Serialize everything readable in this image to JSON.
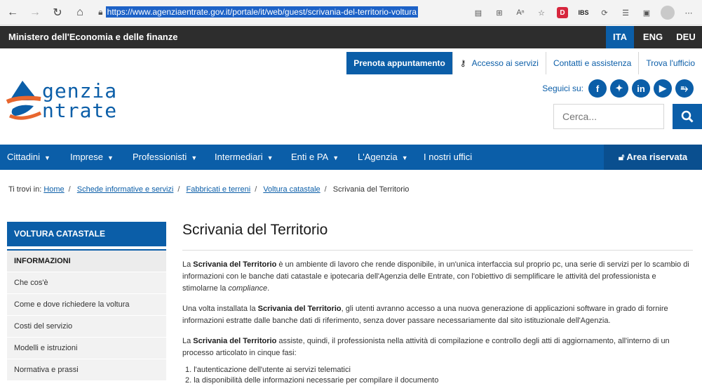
{
  "browser": {
    "url": "https://www.agenziaentrate.gov.it/portale/it/web/guest/scrivania-del-territorio-voltura",
    "icons": [
      "back-icon",
      "forward-icon",
      "refresh-icon",
      "home-icon",
      "lock-icon"
    ],
    "tool_ibs": "IBS",
    "tool_d": "D"
  },
  "ministry": {
    "title": "Ministero dell'Economia e delle finanze",
    "langs": [
      "ITA",
      "ENG",
      "DEU"
    ]
  },
  "header": {
    "links": {
      "prenota": "Prenota appuntamento",
      "accesso": "Accesso ai servizi",
      "contatti": "Contatti e assistenza",
      "trova": "Trova l'ufficio"
    },
    "logo_line1": "genzia",
    "logo_line2": "ntrate",
    "social_label": "Seguici su:",
    "social": [
      "f",
      "t",
      "in",
      "▶",
      "rss"
    ],
    "search_placeholder": "Cerca..."
  },
  "nav": {
    "items": [
      "Cittadini",
      "Imprese",
      "Professionisti",
      "Intermediari",
      "Enti e PA",
      "L'Agenzia",
      "I nostri uffici"
    ],
    "area_riservata": "Area riservata"
  },
  "breadcrumb": {
    "prefix": "Ti trovi in:",
    "links": [
      "Home",
      "Schede informative e servizi",
      "Fabbricati e terreni",
      "Voltura catastale"
    ],
    "current": "Scrivania del Territorio"
  },
  "sidebar": {
    "title": "VOLTURA CATASTALE",
    "items": [
      "INFORMAZIONI",
      "Che cos'è",
      "Come e dove richiedere la voltura",
      "Costi del servizio",
      "Modelli e istruzioni",
      "Normativa e prassi"
    ]
  },
  "content": {
    "title": "Scrivania del Territorio",
    "p1_a": "La ",
    "p1_b": "Scrivania del Territorio",
    "p1_c": " è un ambiente di lavoro che rende disponibile, in un'unica interfaccia sul proprio pc, una serie di servizi per lo scambio di informazioni con le banche dati catastale e ipotecaria dell'Agenzia delle Entrate, con l'obiettivo di semplificare le attività del professionista e stimolarne la ",
    "p1_d": "compliance",
    "p1_e": ".",
    "p2_a": "Una volta installata la ",
    "p2_b": "Scrivania del Territorio",
    "p2_c": ", gli utenti avranno accesso a una nuova generazione di applicazioni software in grado di fornire informazioni estratte dalle banche dati di riferimento, senza dover passare necessariamente dal sito istituzionale dell'Agenzia.",
    "p3_a": "La ",
    "p3_b": "Scrivania del Territorio",
    "p3_c": " assiste, quindi, il professionista nella attività di compilazione e controllo degli atti di aggiornamento, all'interno di un processo articolato in cinque fasi:",
    "steps": [
      "1. l'autenticazione dell'utente ai servizi telematici",
      "2. la disponibilità delle informazioni necessarie per compilare il documento"
    ]
  },
  "colors": {
    "brand_blue": "#0b5ea8",
    "dark_bar": "#2d2d2d",
    "logo_orange": "#e8662e"
  }
}
